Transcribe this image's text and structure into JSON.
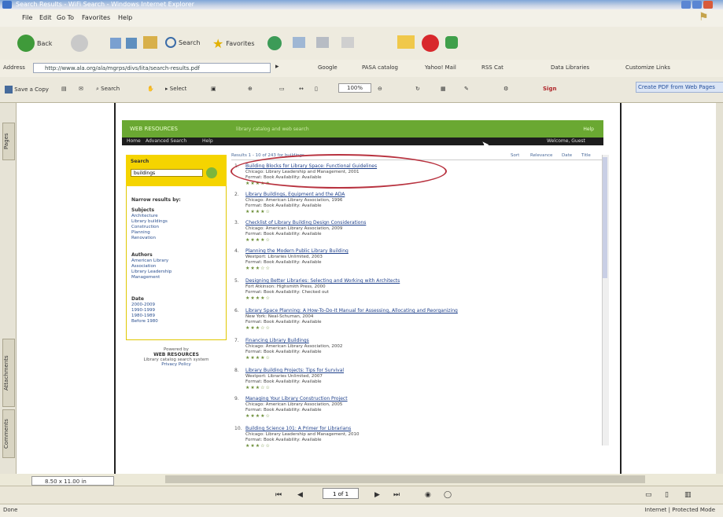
{
  "window": {
    "title": "Search Results - WiFi Search - Windows Internet Explorer"
  },
  "menu": [
    "File",
    "Edit",
    "Go To",
    "Favorites",
    "Help"
  ],
  "toolbar": {
    "back_label": "Back",
    "search_label": "Search",
    "favorites_label": "Favorites"
  },
  "address": {
    "label": "Address",
    "url": "http://www.ala.org/ala/mgrps/divs/lita/search-results.pdf",
    "links": [
      "Google",
      "PASA catalog",
      "Yahoo! Mail",
      "RSS Cat",
      "Data Libraries",
      "Customize Links"
    ]
  },
  "pdf_toolbar": {
    "save_copy_label": "Save a Copy",
    "search_label": "Search",
    "select_label": "Select",
    "zoom_value": "100%",
    "sign_label": "Sign",
    "help_text": "Create PDF from Web Pages"
  },
  "left_panel_tabs": [
    "Pages",
    "Attachments",
    "Comments"
  ],
  "webpage": {
    "brand": "WEB RESOURCES",
    "tagline": "library catalog and web search",
    "header_right": "Help",
    "nav": [
      "Home",
      "Advanced Search",
      "Help"
    ],
    "nav_right": "Welcome, Guest",
    "sidebar": {
      "search_label": "Search",
      "search_value": "buildings",
      "narrow_label": "Narrow results by:",
      "subject_head": "Subjects",
      "subjects": [
        "Architecture",
        "Library buildings",
        "Construction",
        "Planning",
        "Renovation"
      ],
      "author_head": "Authors",
      "authors": [
        "American Library",
        "Association",
        "Library Leadership",
        "Management"
      ],
      "date_head": "Date",
      "dates": [
        "2000-2009",
        "1990-1999",
        "1980-1989",
        "Before 1980"
      ],
      "footer_lines": [
        "Powered by",
        "WEB RESOURCES",
        "Library catalog search system",
        "Privacy Policy"
      ]
    },
    "results_header": {
      "left": "Results 1 - 10 of 243 for buildings",
      "right_items": [
        "Sort",
        "Relevance",
        "Date",
        "Title"
      ]
    },
    "results": [
      {
        "num": "1.",
        "title": "Building Blocks for Library Space: Functional Guidelines",
        "meta1": "Chicago: Library Leadership and Management, 2001",
        "meta2": "Format: Book  Availability: Available",
        "stars": "★★★★★"
      },
      {
        "num": "2.",
        "title": "Library Buildings, Equipment and the ADA",
        "meta1": "Chicago: American Library Association, 1996",
        "meta2": "Format: Book  Availability: Available",
        "stars": "★★★★☆"
      },
      {
        "num": "3.",
        "title": "Checklist of Library Building Design Considerations",
        "meta1": "Chicago: American Library Association, 2009",
        "meta2": "Format: Book  Availability: Available",
        "stars": "★★★★☆"
      },
      {
        "num": "4.",
        "title": "Planning the Modern Public Library Building",
        "meta1": "Westport: Libraries Unlimited, 2003",
        "meta2": "Format: Book  Availability: Available",
        "stars": "★★★☆☆"
      },
      {
        "num": "5.",
        "title": "Designing Better Libraries: Selecting and Working with Architects",
        "meta1": "Fort Atkinson: Highsmith Press, 2000",
        "meta2": "Format: Book  Availability: Checked out",
        "stars": "★★★★☆"
      },
      {
        "num": "6.",
        "title": "Library Space Planning: A How-To-Do-It Manual for Assessing, Allocating and Reorganizing",
        "meta1": "New York: Neal-Schuman, 2004",
        "meta2": "Format: Book  Availability: Available",
        "stars": "★★★☆☆"
      },
      {
        "num": "7.",
        "title": "Financing Library Buildings",
        "meta1": "Chicago: American Library Association, 2002",
        "meta2": "Format: Book  Availability: Available",
        "stars": "★★★★☆"
      },
      {
        "num": "8.",
        "title": "Library Building Projects: Tips for Survival",
        "meta1": "Westport: Libraries Unlimited, 2007",
        "meta2": "Format: Book  Availability: Available",
        "stars": "★★★☆☆"
      },
      {
        "num": "9.",
        "title": "Managing Your Library Construction Project",
        "meta1": "Chicago: American Library Association, 2005",
        "meta2": "Format: Book  Availability: Available",
        "stars": "★★★★☆"
      },
      {
        "num": "10.",
        "title": "Building Science 101: A Primer for Librarians",
        "meta1": "Chicago: Library Leadership and Management, 2010",
        "meta2": "Format: Book  Availability: Available",
        "stars": "★★★☆☆"
      }
    ]
  },
  "statusbar": {
    "zoom_field": "8.50 x 11.00 in",
    "page_box": "1 of 1",
    "left": "Done",
    "right": "Internet | Protected Mode"
  }
}
